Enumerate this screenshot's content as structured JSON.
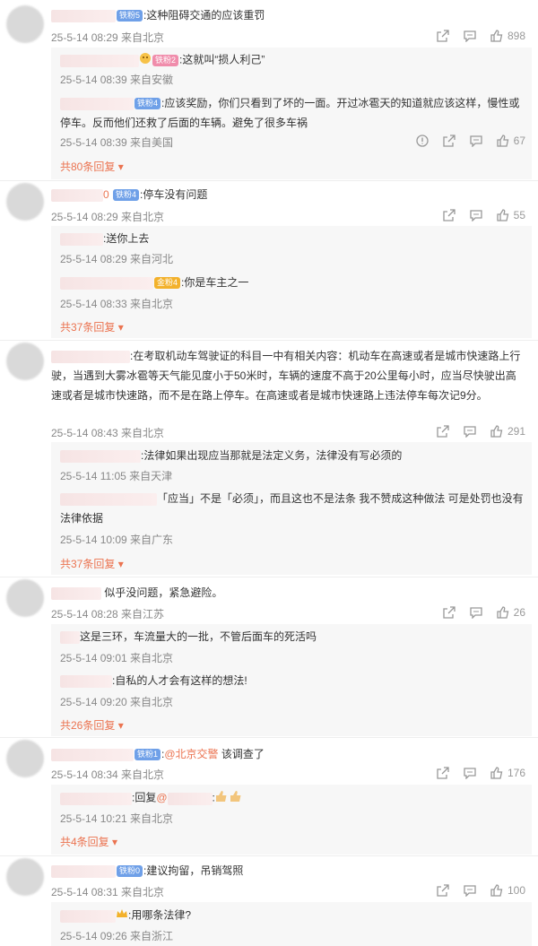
{
  "comments": [
    {
      "text": ":这种阻碍交通的应该重罚",
      "badge": "铁粉5",
      "meta": "25-5-14 08:29 来自北京",
      "likes": "898",
      "replies": [
        {
          "badge": "铁粉2",
          "text": ":这就叫“损人利己”",
          "meta": "25-5-14 08:39 来自安徽"
        },
        {
          "badge": "铁粉4",
          "text": ":应该奖励，你们只看到了坏的一面。开过冰雹天的知道就应该这样，慢性或停车。反而他们还救了后面的车辆。避免了很多车祸",
          "meta": "25-5-14 08:39 来自美国",
          "likes": "67"
        }
      ],
      "more": "共80条回复"
    },
    {
      "text": ":停车没有问题",
      "badge": "铁粉4",
      "name_tail": "0",
      "meta": "25-5-14 08:29 来自北京",
      "likes": "55",
      "replies": [
        {
          "text": ":送你上去",
          "meta": "25-5-14 08:29 来自河北"
        },
        {
          "badge": "金粉4",
          "text": ":你是车主之一",
          "meta": "25-5-14 08:33 来自北京"
        }
      ],
      "more": "共37条回复"
    },
    {
      "text": ":在考取机动车驾驶证的科目一中有相关内容：机动车在高速或者是城市快速路上行驶，当遇到大雾冰雹等天气能见度小于50米时，车辆的速度不高于20公里每小时，应当尽快驶出高速或者是城市快速路，而不是在路上停车。在高速或者是城市快速路上违法停车每次记9分。",
      "meta": "25-5-14 08:43 来自北京",
      "likes": "291",
      "replies": [
        {
          "text": ":法律如果出现应当那就是法定义务，法律没有写必须的",
          "meta": "25-5-14 11:05 来自天津"
        },
        {
          "text": "「应当」不是「必须」，而且这也不是法条 我不赞成这种做法 可是处罚也没有法律依据",
          "meta": "25-5-14 10:09 来自广东"
        }
      ],
      "more": "共37条回复"
    },
    {
      "text": "似乎没问题，紧急避险。",
      "meta": "25-5-14 08:28 来自江苏",
      "likes": "26",
      "replies": [
        {
          "text": "这是三环，车流量大的一批，不管后面车的死活吗",
          "meta": "25-5-14 09:01 来自北京"
        },
        {
          "text": ":自私的人才会有这样的想法!",
          "meta": "25-5-14 09:20 来自北京"
        }
      ],
      "more": "共26条回复"
    },
    {
      "text_prefix": ":",
      "mention": "@北京交警",
      "text_suffix": " 该调查了",
      "badge": "铁粉1",
      "meta": "25-5-14 08:34 来自北京",
      "likes": "176",
      "replies": [
        {
          "text_prefix": ":回复",
          "mention": "@",
          "text_suffix": ":",
          "meta": "25-5-14 10:21 来自北京"
        }
      ],
      "more": "共4条回复"
    },
    {
      "text": ":建议拘留，吊销驾照",
      "badge": "铁粉0",
      "meta": "25-5-14 08:31 来自北京",
      "likes": "100",
      "replies": [
        {
          "text": ":用哪条法律?",
          "meta": "25-5-14 09:26 来自浙江"
        }
      ]
    }
  ],
  "colors": {
    "accent": "#eb7350",
    "meta": "#888888",
    "badge_blue": "#6fa0e8",
    "badge_gold": "#f3b12b"
  },
  "icons": [
    "report-icon",
    "share-icon",
    "comment-icon",
    "like-icon"
  ]
}
